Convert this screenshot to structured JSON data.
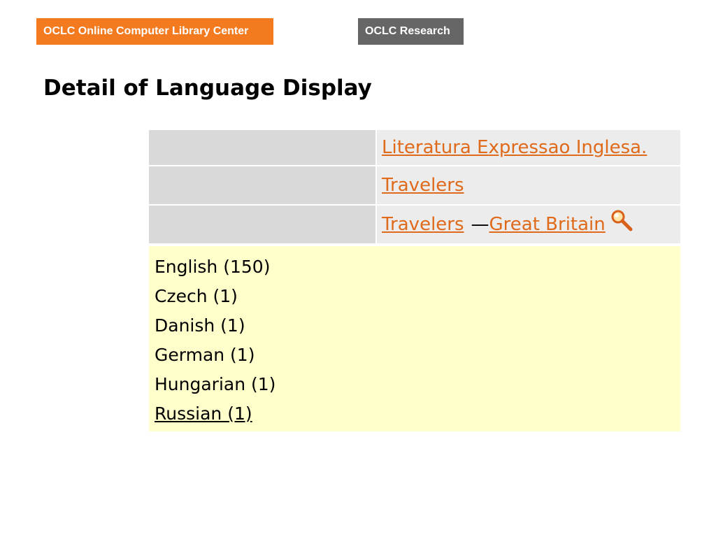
{
  "header": {
    "left_banner": "OCLC Online Computer Library Center",
    "right_banner": "OCLC Research"
  },
  "page": {
    "title": "Detail of Language Display"
  },
  "subjects": [
    {
      "parts": [
        "Literatura Expressao Inglesa."
      ]
    },
    {
      "parts": [
        "Travelers"
      ]
    },
    {
      "parts": [
        "Travelers",
        "Great Britain"
      ],
      "separator": "—",
      "icon": "magnifier-icon"
    }
  ],
  "languages": [
    {
      "label": "English (150)"
    },
    {
      "label": "Czech (1)"
    },
    {
      "label": "Danish (1)"
    },
    {
      "label": "German (1)"
    },
    {
      "label": "Hungarian (1)"
    },
    {
      "label": "Russian (1)",
      "linked": true
    }
  ],
  "colors": {
    "orange_banner": "#f47a20",
    "grey_banner": "#666666",
    "link": "#e06a1b",
    "language_panel": "#ffffcc"
  }
}
